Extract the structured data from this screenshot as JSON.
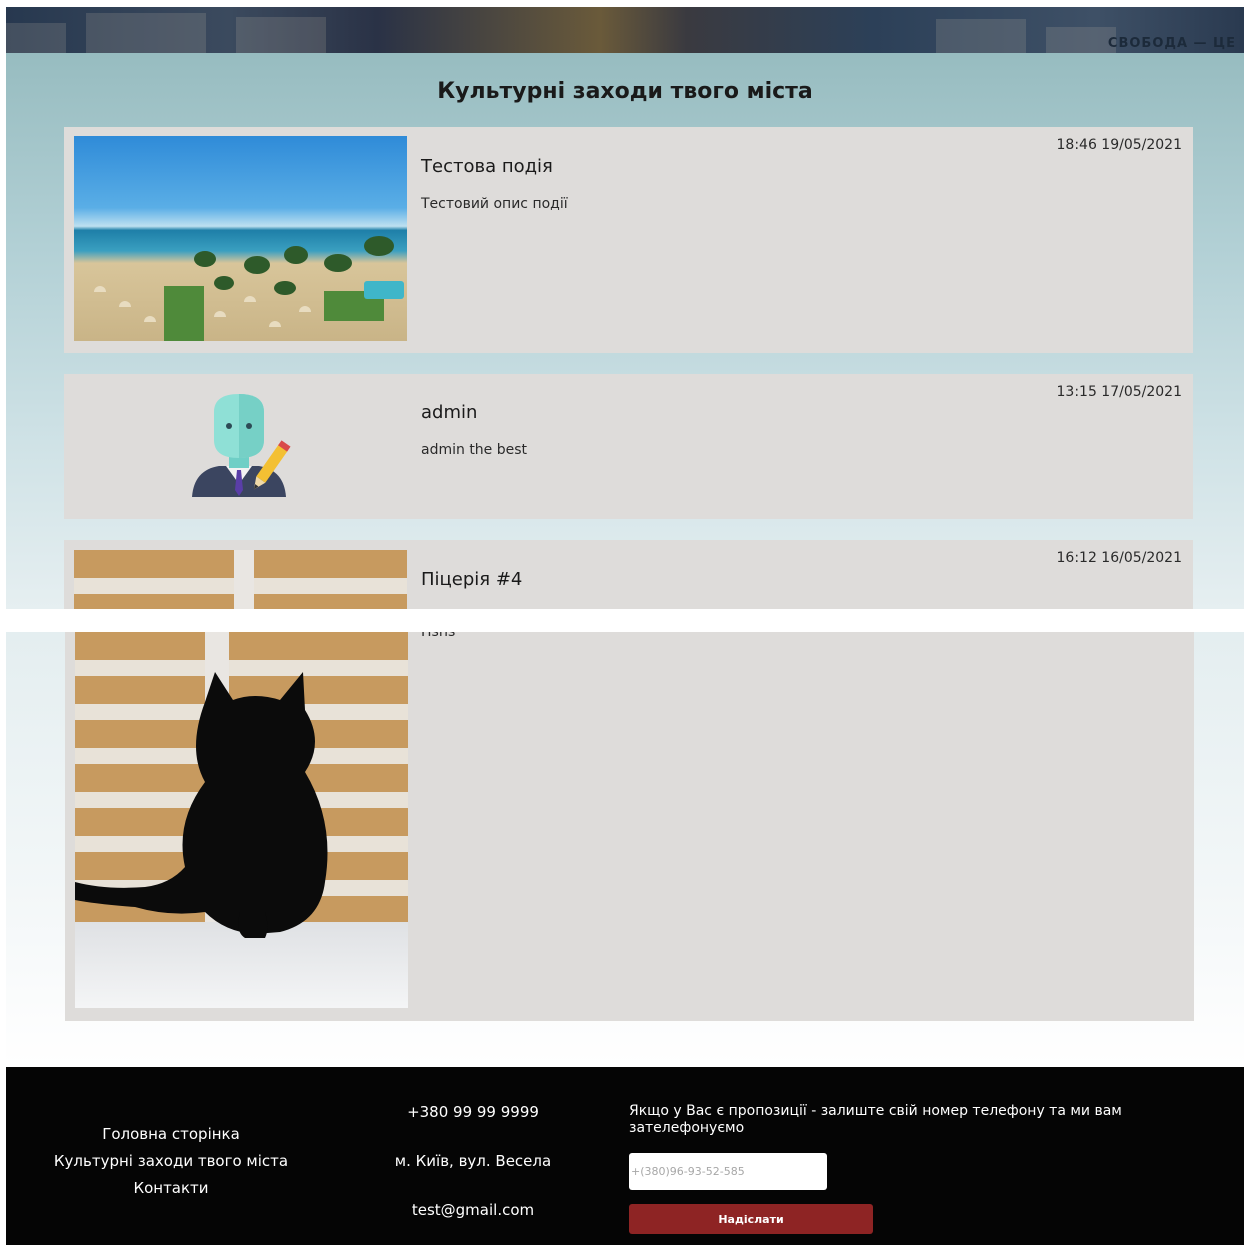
{
  "banner": {
    "text": "СВОБОДА — ЦЕ"
  },
  "page": {
    "title": "Культурні заходи твого міста"
  },
  "events": [
    {
      "title": "Тестова подія",
      "description": "Тестовий опис події",
      "datetime": "18:46 19/05/2021",
      "image": "beach-photo"
    },
    {
      "title": "admin",
      "description": "admin the best",
      "datetime": "13:15 17/05/2021",
      "image": "admin-avatar"
    },
    {
      "title": "Піцерія #4",
      "description": "Пsпs",
      "datetime": "16:12 16/05/2021",
      "image": "cat-photo"
    }
  ],
  "footer": {
    "nav": [
      "Головна сторінка",
      "Культурні заходи твого міста",
      "Контакти"
    ],
    "phone": "+380 99 99 9999",
    "address": "м. Київ, вул. Весела",
    "email": "test@gmail.com",
    "offer_text": "Якщо у Вас є пропозиції - залиште свій номер телефону та ми вам зателефонуємо",
    "phone_placeholder": "+(380)96-93-52-585",
    "submit_label": "Надіслати"
  },
  "colors": {
    "card_bg": "#dedcda",
    "footer_bg": "#050505",
    "button_bg": "#8e2424"
  }
}
